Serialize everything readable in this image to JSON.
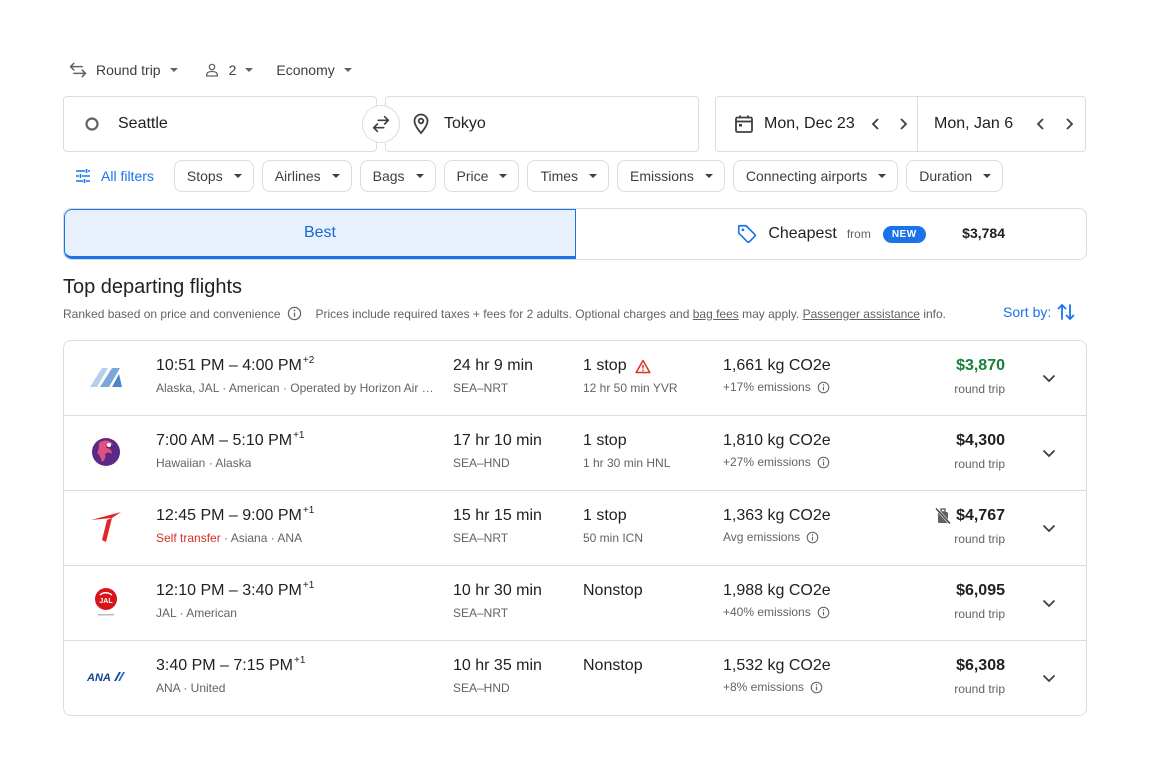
{
  "search": {
    "trip_type": "Round trip",
    "passengers": "2",
    "cabin": "Economy",
    "origin": "Seattle",
    "destination": "Tokyo",
    "depart_date": "Mon, Dec 23",
    "return_date": "Mon, Jan 6"
  },
  "filters": {
    "all_filters": "All filters",
    "chips": [
      "Stops",
      "Airlines",
      "Bags",
      "Price",
      "Times",
      "Emissions",
      "Connecting airports",
      "Duration"
    ]
  },
  "tabs": {
    "best": "Best",
    "cheapest": "Cheapest",
    "cheapest_from": "from",
    "cheapest_price": "$3,784",
    "new_badge": "NEW"
  },
  "section": {
    "title": "Top departing flights",
    "ranked_note": "Ranked based on price and convenience",
    "price_note_1": "Prices include required taxes + fees for 2 adults. Optional charges and ",
    "bag_fees": "bag fees",
    "price_note_2": " may apply. ",
    "passenger_assistance": "Passenger assistance",
    "price_note_3": " info.",
    "sort_by": "Sort by:"
  },
  "flights": [
    {
      "dep": "10:51 PM",
      "arr": "4:00 PM",
      "day_offset": "+2",
      "self_transfer": "",
      "airlines": "Alaska, JAL · American · Operated by Horizon Air …",
      "duration": "24 hr 9 min",
      "route": "SEA–NRT",
      "stops": "1 stop",
      "stop_detail": "12 hr 50 min YVR",
      "emissions": "1,661 kg CO2e",
      "emissions_detail": "+17% emissions",
      "price": "$3,870",
      "price_type": "round trip",
      "logo": "alaska-logo",
      "price_color": "#188038"
    },
    {
      "dep": "7:00 AM",
      "arr": "5:10 PM",
      "day_offset": "+1",
      "self_transfer": "",
      "airlines": "Hawaiian · Alaska",
      "duration": "17 hr 10 min",
      "route": "SEA–HND",
      "stops": "1 stop",
      "stop_detail": "1 hr 30 min HNL",
      "emissions": "1,810 kg CO2e",
      "emissions_detail": "+27% emissions",
      "price": "$4,300",
      "price_type": "round trip",
      "logo": "hawaiian-logo"
    },
    {
      "dep": "12:45 PM",
      "arr": "9:00 PM",
      "day_offset": "+1",
      "self_transfer": "Self transfer",
      "airlines": " · Asiana · ANA",
      "duration": "15 hr 15 min",
      "route": "SEA–NRT",
      "stops": "1 stop",
      "stop_detail": "50 min ICN",
      "emissions": "1,363 kg CO2e",
      "emissions_detail": "Avg emissions",
      "price": "$4,767",
      "price_type": "round trip",
      "logo": "air-premia-logo"
    },
    {
      "dep": "12:10 PM",
      "arr": "3:40 PM",
      "day_offset": "+1",
      "self_transfer": "",
      "airlines": "JAL · American",
      "duration": "10 hr 30 min",
      "route": "SEA–NRT",
      "stops": "Nonstop",
      "stop_detail": "",
      "emissions": "1,988 kg CO2e",
      "emissions_detail": "+40% emissions",
      "price": "$6,095",
      "price_type": "round trip",
      "logo": "jal-logo"
    },
    {
      "dep": "3:40 PM",
      "arr": "7:15 PM",
      "day_offset": "+1",
      "self_transfer": "",
      "airlines": "ANA · United",
      "duration": "10 hr 35 min",
      "route": "SEA–HND",
      "stops": "Nonstop",
      "stop_detail": "",
      "emissions": "1,532 kg CO2e",
      "emissions_detail": "+8% emissions",
      "price": "$6,308",
      "price_type": "round trip",
      "logo": "ana-logo"
    }
  ],
  "jal_logo_text": "JAL",
  "ana_logo_text": "ANA",
  "colors": {
    "accent": "#1a73e8",
    "best_tab_bg": "#e8f0fe",
    "price_green": "#188038",
    "warning_red": "#d93025"
  }
}
